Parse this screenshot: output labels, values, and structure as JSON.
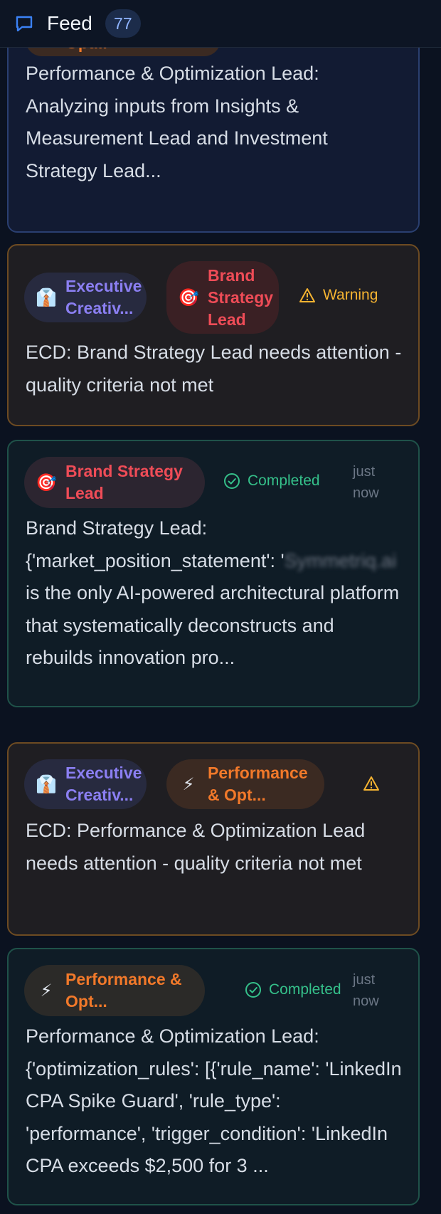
{
  "header": {
    "title": "Feed",
    "count": "77",
    "icon": "chat-bubble-icon"
  },
  "cards": [
    {
      "kind": "info",
      "tag_partial": "Opt...",
      "text": "Performance & Optimization Lead: Analyzing inputs from Insights & Measurement Lead and Investment Strategy Lead..."
    },
    {
      "kind": "warning",
      "from": {
        "icon": "👔",
        "label_l1": "Executive",
        "label_l2": "Creativ..."
      },
      "to": {
        "icon": "🎯",
        "label_l1": "Brand",
        "label_l2": "Strategy",
        "label_l3": "Lead"
      },
      "status": "Warning",
      "text": "ECD: Brand Strategy Lead needs attention - quality criteria not met"
    },
    {
      "kind": "completed",
      "agent": {
        "icon": "🎯",
        "label_l1": "Brand Strategy",
        "label_l2": "Lead"
      },
      "status": "Completed",
      "time_l1": "just",
      "time_l2": "now",
      "text_prefix": "Brand Strategy Lead: {'market_position_statement': '",
      "text_redacted": "Symmetriq.ai",
      "text_suffix": " is the only AI-powered architectural platform that systematically deconstructs and rebuilds innovation pro..."
    },
    {
      "kind": "warning",
      "from": {
        "icon": "👔",
        "label_l1": "Executive",
        "label_l2": "Creativ..."
      },
      "to": {
        "icon": "⚡",
        "label_l1": "Performance",
        "label_l2": "& Opt..."
      },
      "text": "ECD: Performance & Optimization Lead needs attention - quality criteria not met"
    },
    {
      "kind": "completed",
      "agent": {
        "icon": "⚡",
        "label_l1": "Performance &",
        "label_l2": "Opt..."
      },
      "status": "Completed",
      "time_l1": "just",
      "time_l2": "now",
      "text": "Performance & Optimization Lead: {'optimization_rules': [{'rule_name': 'LinkedIn CPA Spike Guard', 'rule_type': 'performance', 'trigger_condition': 'LinkedIn CPA exceeds $2,500 for 3 ..."
    }
  ],
  "colors": {
    "accent_blue": "#8fb4ff",
    "executive": "#8b7ff2",
    "brand": "#ef4c57",
    "performance": "#f2792a",
    "warning": "#f6b431",
    "completed": "#35c08a"
  }
}
